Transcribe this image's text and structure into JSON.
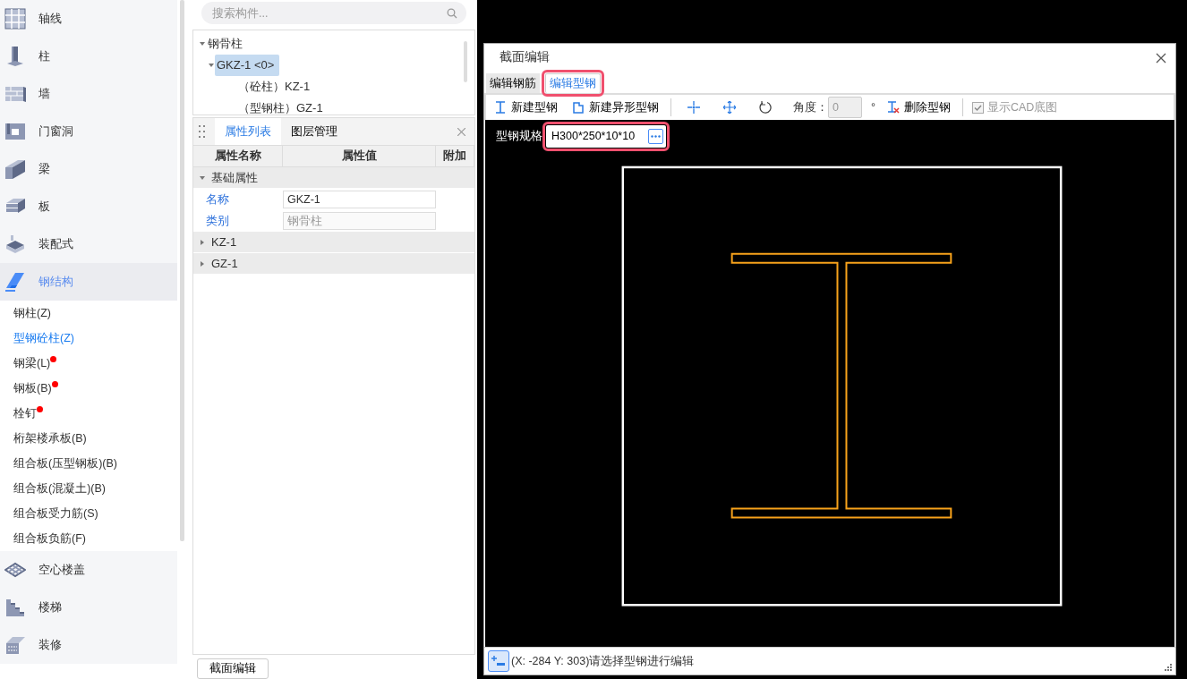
{
  "sidebar": {
    "categories": [
      {
        "label": "轴线",
        "selected": false
      },
      {
        "label": "柱",
        "selected": false
      },
      {
        "label": "墙",
        "selected": false
      },
      {
        "label": "门窗洞",
        "selected": false
      },
      {
        "label": "梁",
        "selected": false
      },
      {
        "label": "板",
        "selected": false
      },
      {
        "label": "装配式",
        "selected": false
      },
      {
        "label": "钢结构",
        "selected": true,
        "items": [
          {
            "label": "钢柱(Z)",
            "selected": false,
            "flagged": false
          },
          {
            "label": "型钢砼柱(Z)",
            "selected": true,
            "flagged": false
          },
          {
            "label": "钢梁(L)",
            "selected": false,
            "flagged": true
          },
          {
            "label": "钢板(B)",
            "selected": false,
            "flagged": true
          },
          {
            "label": "栓钉",
            "selected": false,
            "flagged": true
          },
          {
            "label": "桁架楼承板(B)",
            "selected": false,
            "flagged": false
          },
          {
            "label": "组合板(压型钢板)(B)",
            "selected": false,
            "flagged": false
          },
          {
            "label": "组合板(混凝土)(B)",
            "selected": false,
            "flagged": false
          },
          {
            "label": "组合板受力筋(S)",
            "selected": false,
            "flagged": false
          },
          {
            "label": "组合板负筋(F)",
            "selected": false,
            "flagged": false
          }
        ]
      },
      {
        "label": "空心楼盖",
        "selected": false
      },
      {
        "label": "楼梯",
        "selected": false
      },
      {
        "label": "装修",
        "selected": false
      }
    ]
  },
  "search": {
    "placeholder": "搜索构件..."
  },
  "tree": [
    {
      "label": "钢骨柱",
      "selected": false,
      "expanded": true,
      "children": [
        {
          "label": "GKZ-1 <0>",
          "selected": true,
          "expanded": true,
          "children": [
            {
              "label": "（砼柱）KZ-1",
              "selected": false
            },
            {
              "label": "（型钢柱）GZ-1",
              "selected": false
            }
          ]
        }
      ]
    }
  ],
  "properties": {
    "tabs": [
      {
        "label": "属性列表",
        "selected": true
      },
      {
        "label": "图层管理",
        "selected": false
      }
    ],
    "columns": [
      "属性名称",
      "属性值",
      "附加"
    ],
    "groups": [
      {
        "label": "基础属性",
        "expanded": true,
        "rows": [
          {
            "name": "名称",
            "value": "GKZ-1",
            "disabled": false
          },
          {
            "name": "类别",
            "value": "钢骨柱",
            "disabled": true
          }
        ]
      },
      {
        "label": "KZ-1",
        "expanded": false
      },
      {
        "label": "GZ-1",
        "expanded": false
      }
    ]
  },
  "bottom_button": "截面编辑",
  "dialog": {
    "title": "截面编辑",
    "tabs": [
      {
        "label": "编辑钢筋",
        "selected": false,
        "highlighted": false
      },
      {
        "label": "编辑型钢",
        "selected": true,
        "highlighted": true
      }
    ],
    "toolbar": [
      {
        "kind": "button",
        "label": "新建型钢"
      },
      {
        "kind": "button",
        "label": "新建异形型钢"
      },
      {
        "kind": "separator"
      },
      {
        "kind": "icon"
      },
      {
        "kind": "icon"
      },
      {
        "kind": "icon"
      },
      {
        "kind": "field",
        "label": "角度：",
        "value": "0",
        "unit": "°",
        "disabled": true
      },
      {
        "kind": "button",
        "label": "删除型钢"
      },
      {
        "kind": "separator"
      },
      {
        "kind": "checkbox",
        "label": "显示CAD底图",
        "checked": true,
        "disabled": true
      }
    ],
    "spec": {
      "label": "型钢规格",
      "value": "H300*250*10*10",
      "highlighted": true
    },
    "status": "(X: -284 Y: 303)请选择型钢进行编辑"
  }
}
